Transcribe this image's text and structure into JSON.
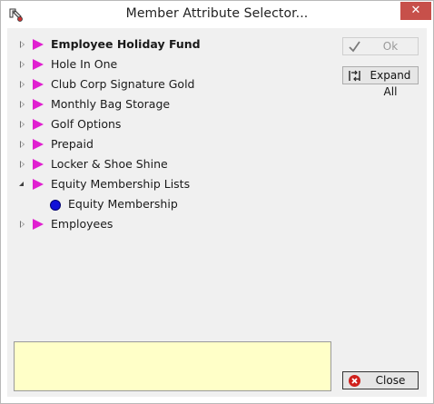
{
  "window": {
    "title": "Member Attribute Selector...",
    "close_label": "✕"
  },
  "tree": {
    "items": [
      {
        "label": "Employee Holiday Fund",
        "bold": true,
        "state": "collapsed",
        "icon": "flag-icon"
      },
      {
        "label": "Hole In One",
        "state": "collapsed",
        "icon": "flag-icon"
      },
      {
        "label": "Club Corp Signature Gold",
        "state": "collapsed",
        "icon": "flag-icon"
      },
      {
        "label": "Monthly Bag Storage",
        "state": "collapsed",
        "icon": "flag-icon"
      },
      {
        "label": "Golf Options",
        "state": "collapsed",
        "icon": "flag-icon"
      },
      {
        "label": "Prepaid",
        "state": "collapsed",
        "icon": "flag-icon"
      },
      {
        "label": "Locker & Shoe Shine",
        "state": "collapsed",
        "icon": "flag-icon"
      },
      {
        "label": "Equity Membership Lists",
        "state": "expanded",
        "icon": "flag-icon"
      },
      {
        "label": "Equity Membership",
        "child": true,
        "icon": "blue-dot-icon"
      },
      {
        "label": "Employees",
        "state": "collapsed",
        "icon": "flag-icon"
      }
    ]
  },
  "notes": {
    "value": ""
  },
  "buttons": {
    "ok": {
      "label": "Ok",
      "enabled": false,
      "icon": "checkmark-icon"
    },
    "expand_all": {
      "label": "Expand All",
      "icon": "expand-all-icon"
    },
    "close": {
      "label": "Close",
      "icon": "red-x-circle-icon"
    }
  },
  "colors": {
    "flag": "#e020d0",
    "dot": "#1010d8",
    "notes_bg": "#ffffc8",
    "close_accent": "#d0201c"
  }
}
